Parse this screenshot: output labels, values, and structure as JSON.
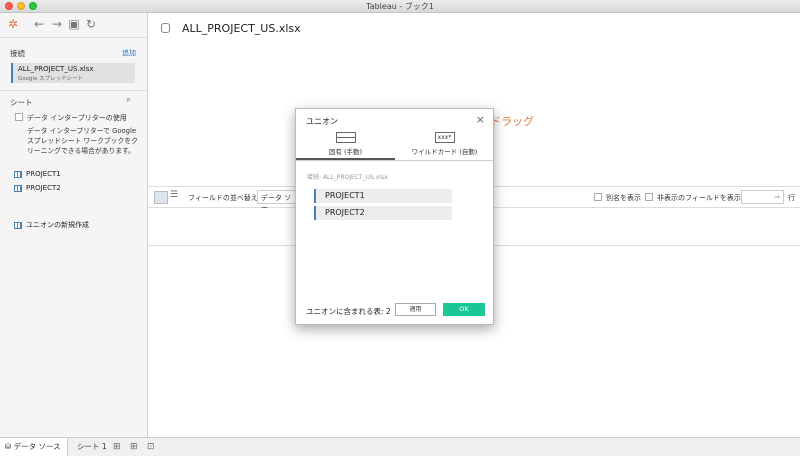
{
  "window": {
    "title": "Tableau - ブック1"
  },
  "sidebar": {
    "connections_label": "接続",
    "add_label": "追加",
    "connection_name": "ALL_PROJECT_US.xlsx",
    "connection_type": "Google スプレッドシート",
    "sheets_label": "シート",
    "interpreter_label": "データ インタープリターの使用",
    "interpreter_desc": "データ インタープリターで Google スプレッドシート ワークブックをクリーニングできる場合があります。",
    "sheets": [
      "PROJECT1",
      "PROJECT2"
    ],
    "new_union": "ユニオンの新規作成"
  },
  "main": {
    "title": "ALL_PROJECT_US.xlsx",
    "drag_hint": "ドラッグ"
  },
  "grid_toolbar": {
    "sort_label": "フィールドの並べ替え",
    "sort_value": "データ ソー",
    "alias_label": "別名を表示",
    "hidden_label": "非表示のフィールドを表示",
    "rows_label": "行"
  },
  "bottom": {
    "datasource_tab": "データ ソース",
    "sheet_tab": "シート 1"
  },
  "dialog": {
    "title": "ユニオン",
    "tab_fixed": "固有 (手動)",
    "tab_wildcard": "ワイルドカード (自動)",
    "wildcard_icon_text": "xxx*",
    "connection_line": "接続: ALL_PROJECT_US.xlsx",
    "tables": [
      "PROJECT1",
      "PROJECT2"
    ],
    "count_label": "ユニオンに含まれる表: 2",
    "apply_label": "適用",
    "ok_label": "OK"
  }
}
